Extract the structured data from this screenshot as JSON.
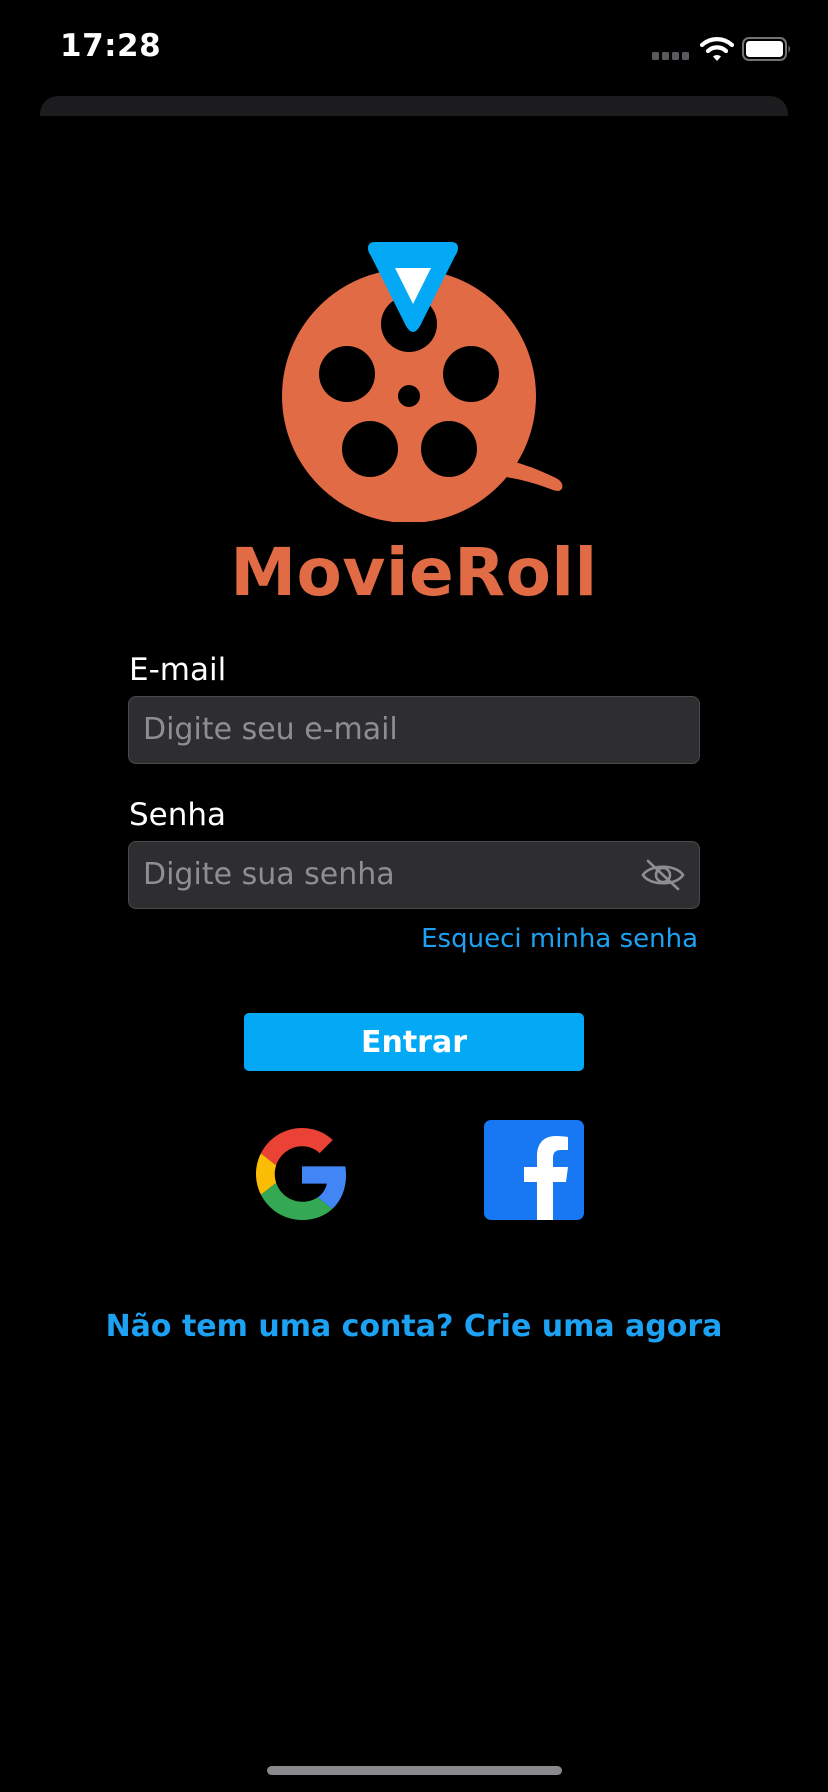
{
  "status_bar": {
    "time": "17:28"
  },
  "brand": {
    "name": "MovieRoll",
    "logo_icon": "film-reel-icon",
    "primary_color": "#e06b45",
    "accent_color": "#03a9f4"
  },
  "login_form": {
    "email": {
      "label": "E-mail",
      "placeholder": "Digite seu e-mail",
      "value": ""
    },
    "password": {
      "label": "Senha",
      "placeholder": "Digite sua senha",
      "value": "",
      "visibility_icon": "eye-slash-icon"
    },
    "forgot_password_label": "Esqueci minha senha",
    "submit_label": "Entrar"
  },
  "social_login": {
    "google_icon": "google-icon",
    "facebook_icon": "facebook-icon"
  },
  "signup_prompt": "Não tem uma conta? Crie uma agora"
}
